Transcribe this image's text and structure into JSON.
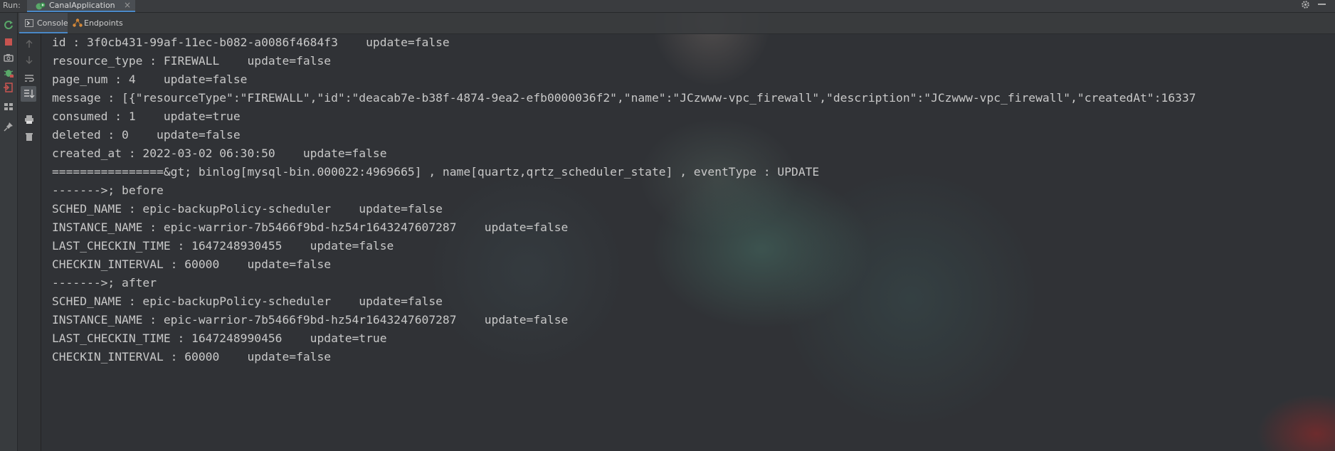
{
  "run_bar": {
    "label": "Run:",
    "tab_title": "CanalApplication",
    "tab_close": "×",
    "icons": [
      "app-run-icon",
      "settings-icon",
      "minimize-icon"
    ]
  },
  "left_toolbar": {
    "icons": [
      "rerun-icon",
      "stop-icon",
      "camera-icon",
      "debug-icon",
      "exit-icon",
      "layout-icon",
      "pin-icon"
    ]
  },
  "scroll_toolbar": {
    "icons": [
      "scroll-up-icon",
      "scroll-down-icon",
      "soft-wrap-icon",
      "scroll-to-end-icon",
      "print-icon",
      "clear-icon"
    ]
  },
  "sub_tabs": [
    {
      "label": "Console",
      "icon": "console-icon",
      "active": true
    },
    {
      "label": "Endpoints",
      "icon": "endpoints-icon",
      "active": false
    }
  ],
  "console": {
    "lines": [
      "id : 3f0cb431-99af-11ec-b082-a0086f4684f3    update=false",
      "resource_type : FIREWALL    update=false",
      "page_num : 4    update=false",
      "message : [{\"resourceType\":\"FIREWALL\",\"id\":\"deacab7e-b38f-4874-9ea2-efb0000036f2\",\"name\":\"JCzwww-vpc_firewall\",\"description\":\"JCzwww-vpc_firewall\",\"createdAt\":16337",
      "consumed : 1    update=true",
      "deleted : 0    update=false",
      "created_at : 2022-03-02 06:30:50    update=false",
      "================&gt; binlog[mysql-bin.000022:4969665] , name[quartz,qrtz_scheduler_state] , eventType : UPDATE",
      "------->; before",
      "SCHED_NAME : epic-backupPolicy-scheduler    update=false",
      "INSTANCE_NAME : epic-warrior-7b5466f9bd-hz54r1643247607287    update=false",
      "LAST_CHECKIN_TIME : 1647248930455    update=false",
      "CHECKIN_INTERVAL : 60000    update=false",
      "------->; after",
      "SCHED_NAME : epic-backupPolicy-scheduler    update=false",
      "INSTANCE_NAME : epic-warrior-7b5466f9bd-hz54r1643247607287    update=false",
      "LAST_CHECKIN_TIME : 1647248990456    update=true",
      "CHECKIN_INTERVAL : 60000    update=false"
    ]
  },
  "colors": {
    "accent": "#4a88c7",
    "stop": "#c75450",
    "run": "#59a869",
    "console_text": "#c8c8c8"
  }
}
